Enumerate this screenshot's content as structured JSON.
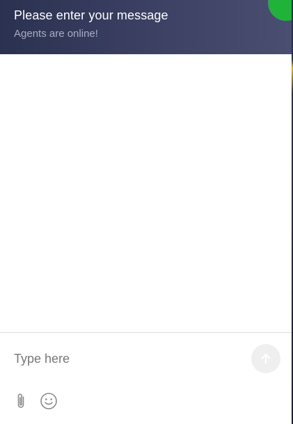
{
  "header": {
    "title": "Please enter your message",
    "subtitle": "Agents are online!",
    "status_color": "#1fb33a",
    "background_color": "#2b3150"
  },
  "composer": {
    "input_placeholder": "Type here",
    "input_value": "",
    "send_icon": "arrow-up-icon",
    "attach_icon": "paperclip-icon",
    "emoji_icon": "smiley-icon"
  }
}
